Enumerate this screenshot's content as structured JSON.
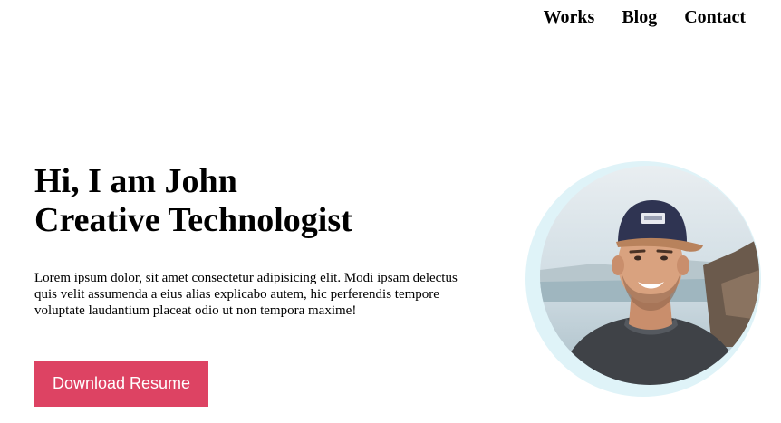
{
  "nav": {
    "items": [
      {
        "label": "Works"
      },
      {
        "label": "Blog"
      },
      {
        "label": "Contact"
      }
    ]
  },
  "hero": {
    "greeting": "Hi, I am John",
    "role": "Creative Technologist",
    "description": "Lorem ipsum dolor, sit amet consectetur adipisicing elit. Modi ipsam delectus quis velit assumenda a eius alias explicabo autem, hic perferendis tempore voluptate laudantium placeat odio ut non tempora maxime!",
    "button_label": "Download Resume"
  },
  "colors": {
    "accent": "#dd4363",
    "avatar_ring": "#dff3f8"
  }
}
